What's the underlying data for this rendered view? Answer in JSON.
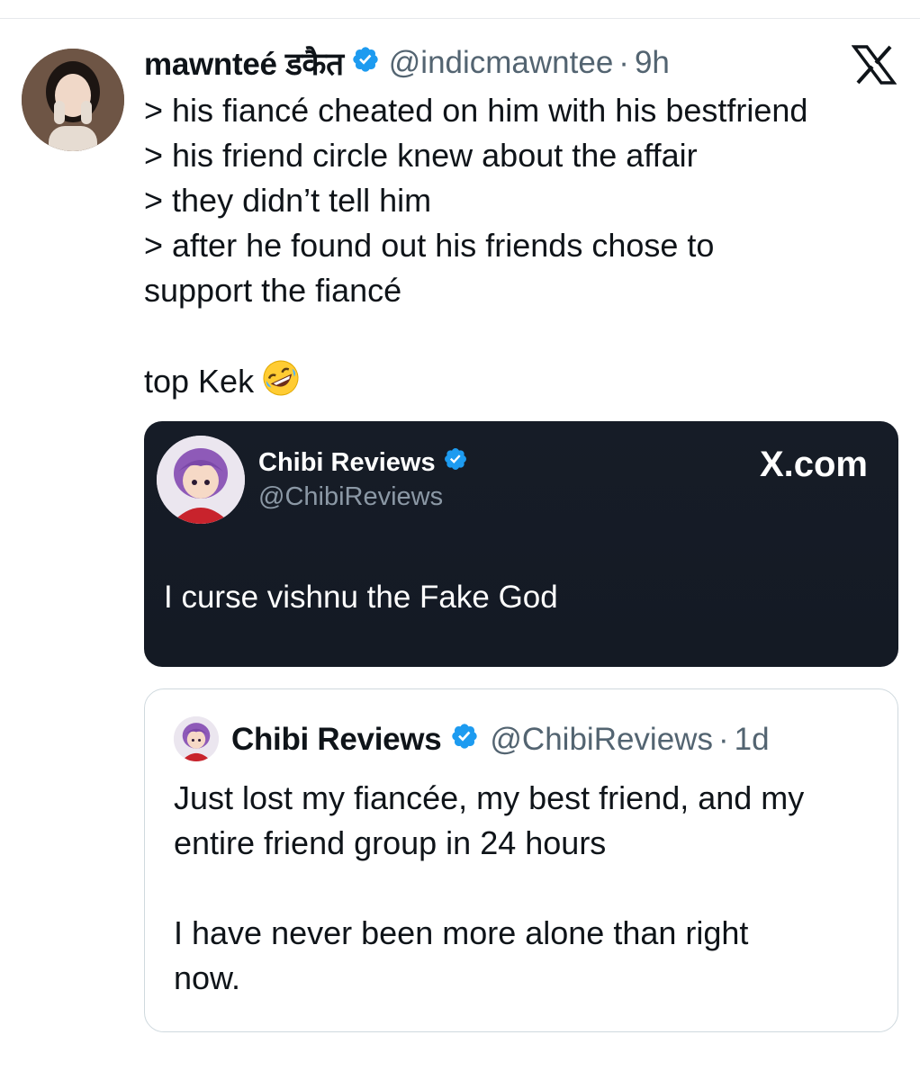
{
  "tweet": {
    "display_name": "mawnteé डकैत",
    "handle": "@indicmawntee",
    "separator": "·",
    "time": "9h",
    "avatar_icon": "user-avatar-icon",
    "verified_color": "#1d9bf0",
    "lines": [
      "> his fiancé cheated on him with his bestfriend",
      "> his friend circle knew about the affair",
      "> they didn’t tell him",
      "> after he found out his friends chose to",
      "support the fiancé"
    ],
    "closing_text": "top Kek",
    "closing_emoji": "rolling-on-floor-laughing-emoji"
  },
  "embedded_card": {
    "display_name": "Chibi Reviews",
    "handle": "@ChibiReviews",
    "brand": "X.com",
    "text": "I curse vishnu the Fake God",
    "background": "#151a24"
  },
  "quoted_tweet": {
    "display_name": "Chibi Reviews",
    "handle": "@ChibiReviews",
    "separator": "·",
    "time": "1d",
    "paragraph1_line1": "Just lost my fiancée, my best friend, and my",
    "paragraph1_line2": "entire friend group in 24 hours",
    "paragraph2_line1": "I have never been more alone than right",
    "paragraph2_line2": "now."
  }
}
